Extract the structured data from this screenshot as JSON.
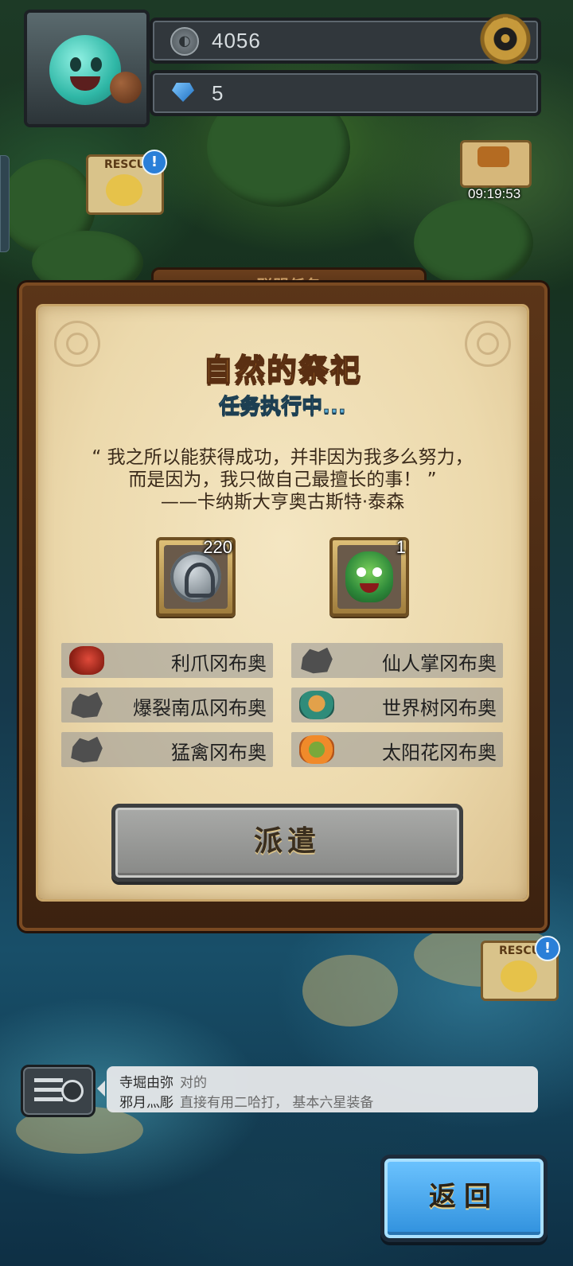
{
  "hud": {
    "coins": "4056",
    "gems": "5",
    "chest_timer": "09:19:53",
    "rescue_label": "RESCU",
    "alert_mark": "!"
  },
  "panel": {
    "header_label": "联盟任务",
    "task_title": "自然的祭祀",
    "task_status": "任务执行中...",
    "quote_lines": [
      "“ 我之所以能获得成功，并非因为我多么努力，",
      "而是因为，我只做自己最擅长的事！ ”",
      "——卡纳斯大亨奥古斯特·泰森"
    ],
    "rewards": [
      {
        "icon": "silver-helmet-coin-icon",
        "count": "220"
      },
      {
        "icon": "green-monster-icon",
        "count": "1"
      }
    ],
    "goblins": [
      {
        "name": "利爪冈布奥",
        "icon": "red-goblin-icon",
        "owned": true
      },
      {
        "name": "仙人掌冈布奥",
        "icon": "silhouette-icon",
        "owned": false
      },
      {
        "name": "爆裂南瓜冈布奥",
        "icon": "silhouette-icon",
        "owned": false
      },
      {
        "name": "世界树冈布奥",
        "icon": "world-tree-goblin-icon",
        "owned": true
      },
      {
        "name": "猛禽冈布奥",
        "icon": "silhouette-icon",
        "owned": false
      },
      {
        "name": "太阳花冈布奥",
        "icon": "sunflower-goblin-icon",
        "owned": true
      }
    ],
    "dispatch_label": "派遣"
  },
  "chat": {
    "messages": [
      {
        "user": "寺堀由弥",
        "text": "对的"
      },
      {
        "user": "邪月灬彫",
        "text": "直接有用二哈打， 基本六星装备"
      }
    ]
  },
  "back_label": "返回"
}
